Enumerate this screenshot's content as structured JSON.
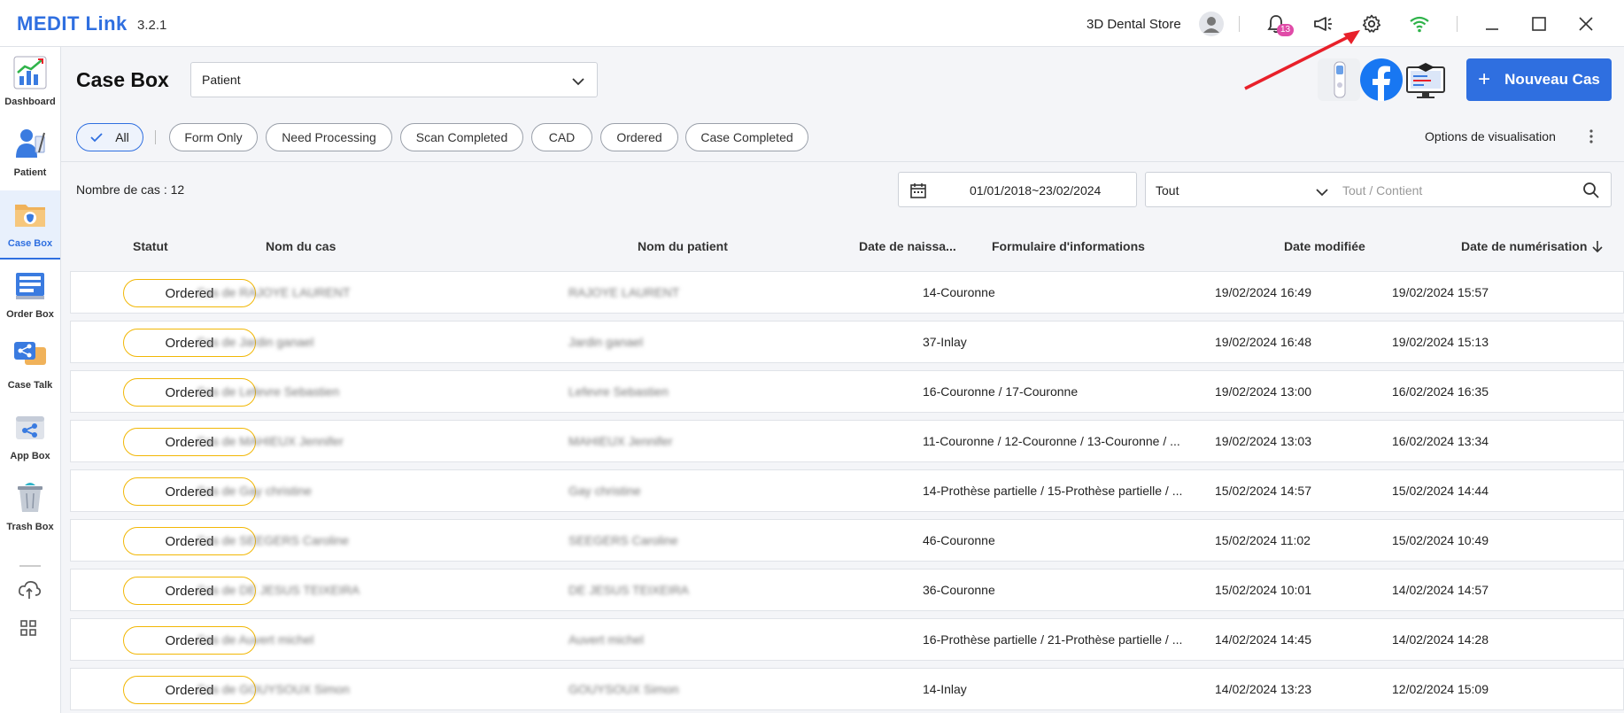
{
  "app": {
    "brand": "MEDIT Link",
    "version": "3.2.1",
    "store": "3D Dental Store",
    "notifications": "13"
  },
  "sidebar": {
    "items": [
      {
        "label": "Dashboard",
        "icon": "dashboard-icon"
      },
      {
        "label": "Patient",
        "icon": "patient-icon"
      },
      {
        "label": "Case Box",
        "icon": "case-box-icon",
        "active": true
      },
      {
        "label": "Order Box",
        "icon": "order-box-icon"
      },
      {
        "label": "Case Talk",
        "icon": "case-talk-icon"
      },
      {
        "label": "App Box",
        "icon": "app-box-icon"
      },
      {
        "label": "Trash Box",
        "icon": "trash-box-icon"
      }
    ]
  },
  "header": {
    "title": "Case Box",
    "select_value": "Patient",
    "new_case": "Nouveau Cas"
  },
  "filters": {
    "chips": [
      "All",
      "Form Only",
      "Need Processing",
      "Scan Completed",
      "CAD",
      "Ordered",
      "Case Completed"
    ],
    "view_options": "Options de visualisation"
  },
  "toolbar": {
    "count": "Nombre de cas : 12",
    "date_range": "01/01/2018~23/02/2024",
    "scope": "Tout",
    "search_placeholder": "Tout / Contient"
  },
  "table": {
    "columns": [
      "Statut",
      "Nom du cas",
      "Nom du patient",
      "Date de naissa...",
      "Formulaire d'informations",
      "Date modifiée",
      "Date de numérisation"
    ],
    "rows": [
      {
        "status": "Ordered",
        "case": "Cas de RAJOYE LAURENT",
        "patient": "RAJOYE LAURENT",
        "form": "14-Couronne",
        "modified": "19/02/2024 16:49",
        "scanned": "19/02/2024 15:57"
      },
      {
        "status": "Ordered",
        "case": "Cas de Jardin ganael",
        "patient": "Jardin ganael",
        "form": "37-Inlay",
        "modified": "19/02/2024 16:48",
        "scanned": "19/02/2024 15:13"
      },
      {
        "status": "Ordered",
        "case": "Cas de Lefevre Sebastien",
        "patient": "Lefevre Sebastien",
        "form": "16-Couronne / 17-Couronne",
        "modified": "19/02/2024 13:00",
        "scanned": "16/02/2024 16:35"
      },
      {
        "status": "Ordered",
        "case": "Cas de MAHIEUX Jennifer",
        "patient": "MAHIEUX Jennifer",
        "form": "11-Couronne / 12-Couronne / 13-Couronne / ...",
        "modified": "19/02/2024 13:03",
        "scanned": "16/02/2024 13:34"
      },
      {
        "status": "Ordered",
        "case": "Cas de Gay christine",
        "patient": "Gay christine",
        "form": "14-Prothèse partielle / 15-Prothèse partielle / ...",
        "modified": "15/02/2024 14:57",
        "scanned": "15/02/2024 14:44"
      },
      {
        "status": "Ordered",
        "case": "Cas de SEEGERS Caroline",
        "patient": "SEEGERS Caroline",
        "form": "46-Couronne",
        "modified": "15/02/2024 11:02",
        "scanned": "15/02/2024 10:49"
      },
      {
        "status": "Ordered",
        "case": "Cas de DE JESUS TEIXEIRA",
        "patient": "DE JESUS TEIXEIRA",
        "form": "36-Couronne",
        "modified": "15/02/2024 10:01",
        "scanned": "14/02/2024 14:57"
      },
      {
        "status": "Ordered",
        "case": "Cas de Auvert michel",
        "patient": "Auvert michel",
        "form": "16-Prothèse partielle / 21-Prothèse partielle / ...",
        "modified": "14/02/2024 14:45",
        "scanned": "14/02/2024 14:28"
      },
      {
        "status": "Ordered",
        "case": "Cas de GOUYSOUX Simon",
        "patient": "GOUYSOUX Simon",
        "form": "14-Inlay",
        "modified": "14/02/2024 13:23",
        "scanned": "12/02/2024 15:09"
      }
    ]
  },
  "colors": {
    "accent": "#2f6fe0",
    "ordered_border": "#f2b705",
    "notif": "#e04ba8",
    "wifi": "#2fb34a",
    "annotation": "#e8202a"
  }
}
